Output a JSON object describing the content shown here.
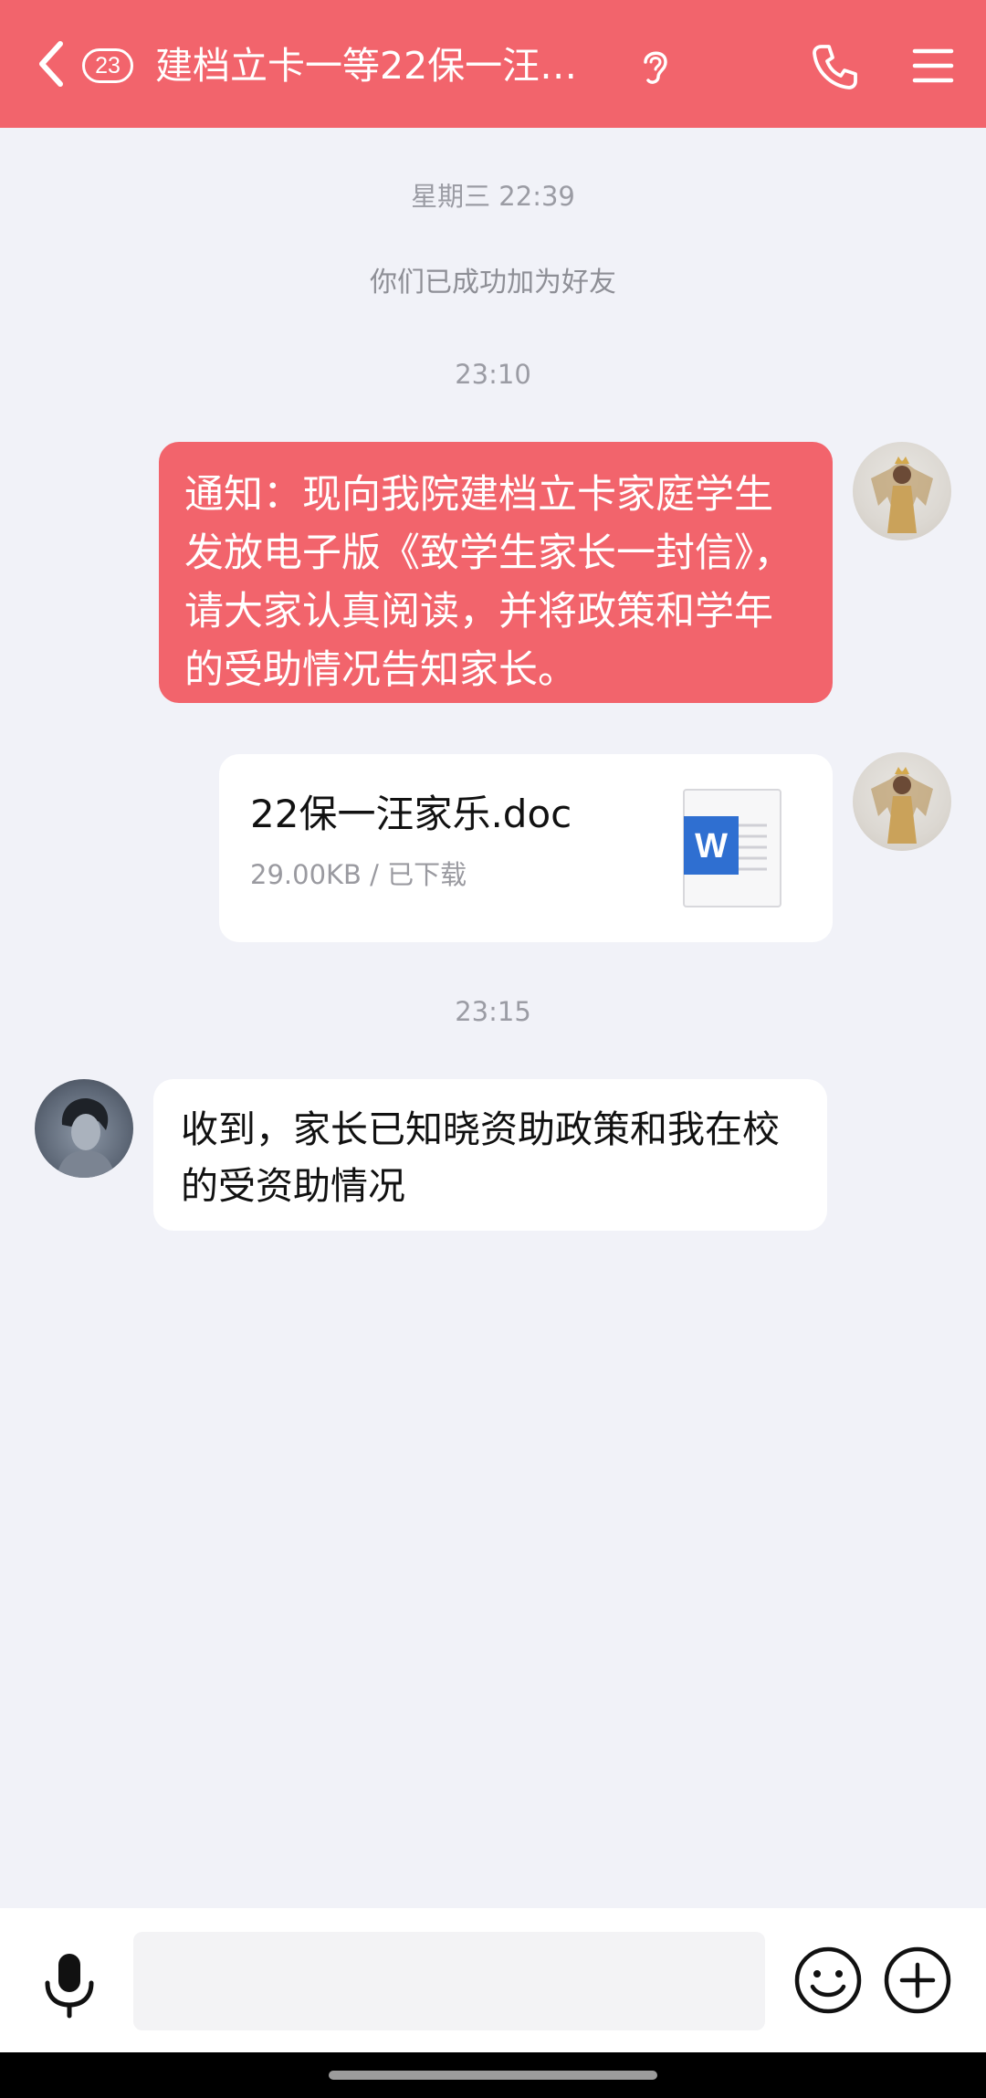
{
  "header": {
    "unread_count": "23",
    "title": "建档立卡一等22保一汪…",
    "accent_color": "#f2646c",
    "icons": [
      "back-arrow-icon",
      "ear-icon",
      "phone-icon",
      "menu-icon"
    ]
  },
  "messages": {
    "time_1": "星期三 22:39",
    "system_notice": "你们已成功加为好友",
    "time_2": "23:10",
    "notice_text": " 通知：现向我院建档立卡家庭学生发放电子版《致学生家长一封信》，请大家认真阅读，并将政策和学年的受助情况告知家长。",
    "file": {
      "name": "22保一汪家乐.doc",
      "meta": "29.00KB / 已下载",
      "icon": "word-doc-icon"
    },
    "time_3": "23:15",
    "reply_text": "收到，家长已知晓资助政策和我在校的受资助情况"
  },
  "input_bar": {
    "value": "",
    "placeholder": "",
    "icons": [
      "microphone-icon",
      "emoji-icon",
      "plus-icon"
    ]
  }
}
